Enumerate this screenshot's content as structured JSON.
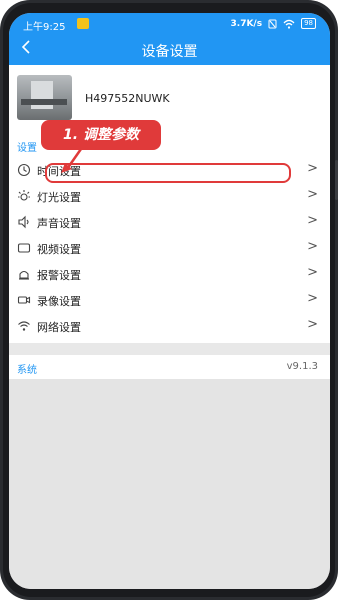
{
  "status_bar": {
    "time": "上午9:25",
    "network_speed": "3.7K/s",
    "battery": "98"
  },
  "header": {
    "back_icon": "chevron-left-icon",
    "title": "设备设置"
  },
  "device": {
    "id": "H497552NUWK"
  },
  "settings": {
    "section_label": "设置",
    "items": [
      {
        "label": "时间设置",
        "icon": "clock-icon"
      },
      {
        "label": "灯光设置",
        "icon": "light-icon"
      },
      {
        "label": "声音设置",
        "icon": "speaker-icon"
      },
      {
        "label": "视频设置",
        "icon": "video-icon"
      },
      {
        "label": "报警设置",
        "icon": "alarm-icon"
      },
      {
        "label": "录像设置",
        "icon": "camera-icon"
      },
      {
        "label": "网络设置",
        "icon": "wifi-icon"
      }
    ],
    "chevron": ">"
  },
  "annotation": {
    "text": "1. 调整参数",
    "color": "#e03a3a"
  },
  "system": {
    "label": "系统",
    "version": "v9.1.3"
  },
  "colors": {
    "accent": "#2196f3",
    "highlight": "#e03a3a"
  }
}
